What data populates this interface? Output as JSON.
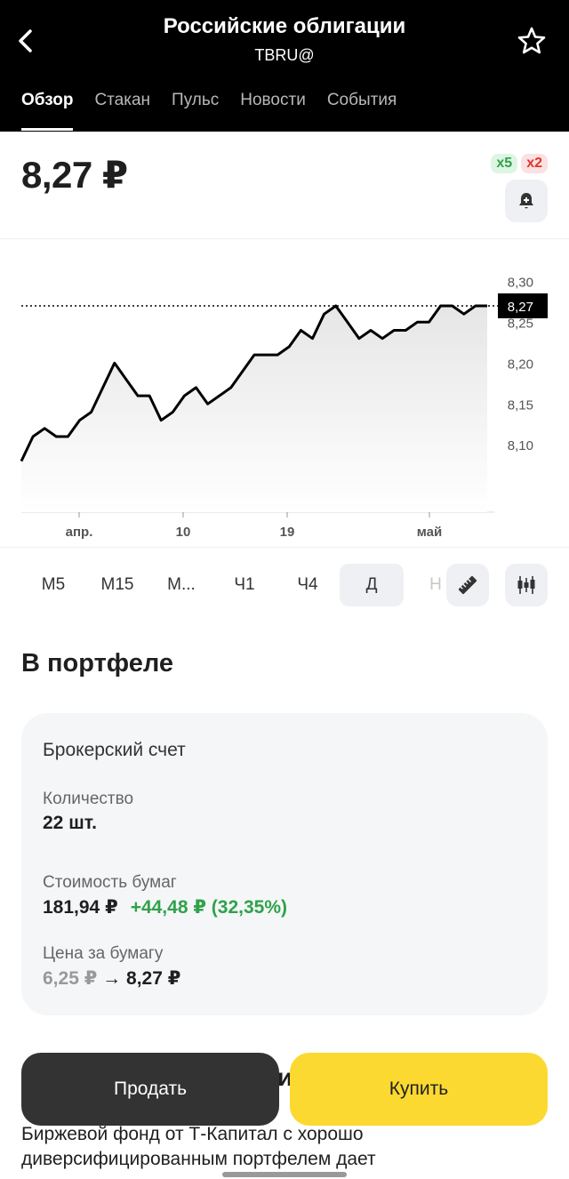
{
  "header": {
    "title": "Российские облигации",
    "ticker": "TBRU@",
    "tabs": [
      "Обзор",
      "Стакан",
      "Пульс",
      "Новости",
      "События"
    ],
    "active_tab": "Обзор"
  },
  "price": {
    "current": "8,27 ₽",
    "badge_x5": "x5",
    "badge_x2": "x2"
  },
  "intervals": {
    "items": [
      "M5",
      "M15",
      "M...",
      "Ч1",
      "Ч4",
      "Д",
      "Н"
    ],
    "active": "Д"
  },
  "chart_data": {
    "type": "line",
    "y_ticks": [
      "8,30",
      "8,25",
      "8,20",
      "8,15",
      "8,10"
    ],
    "x_ticks": [
      "апр.",
      "10",
      "19",
      "май"
    ],
    "current_label": "8,27",
    "ylim": [
      8.06,
      8.32
    ],
    "values": [
      8.08,
      8.11,
      8.12,
      8.11,
      8.11,
      8.13,
      8.14,
      8.17,
      8.2,
      8.18,
      8.16,
      8.16,
      8.13,
      8.14,
      8.16,
      8.17,
      8.15,
      8.16,
      8.17,
      8.19,
      8.21,
      8.21,
      8.21,
      8.22,
      8.24,
      8.23,
      8.26,
      8.27,
      8.25,
      8.23,
      8.24,
      8.23,
      8.24,
      8.24,
      8.25,
      8.25,
      8.27,
      8.27,
      8.26,
      8.27,
      8.27
    ],
    "colors": {
      "line": "#000000",
      "fill_top": "#e9e9e9",
      "label_bg": "#000000"
    }
  },
  "portfolio": {
    "section_title": "В портфеле",
    "account": "Брокерский счет",
    "qty_label": "Количество",
    "qty_value": "22 шт.",
    "cost_label": "Стоимость бумаг",
    "cost_value": "181,94 ₽",
    "cost_gain": "+44,48 ₽ (32,35%)",
    "price_label": "Цена за бумагу",
    "price_from": "6,25 ₽",
    "price_arrow": "→",
    "price_to": "8,27 ₽"
  },
  "actions": {
    "sell": "Продать",
    "buy": "Купить"
  },
  "about": {
    "heading_fragment": "и",
    "description": "Биржевой фонд от Т-Капитал с хорошо диверсифицированным портфелем дает"
  },
  "theme": {
    "header_bg": "#000000",
    "accent_yellow": "#fbd930",
    "gain_green": "#2fa24a",
    "loss_red": "#e0332f"
  }
}
